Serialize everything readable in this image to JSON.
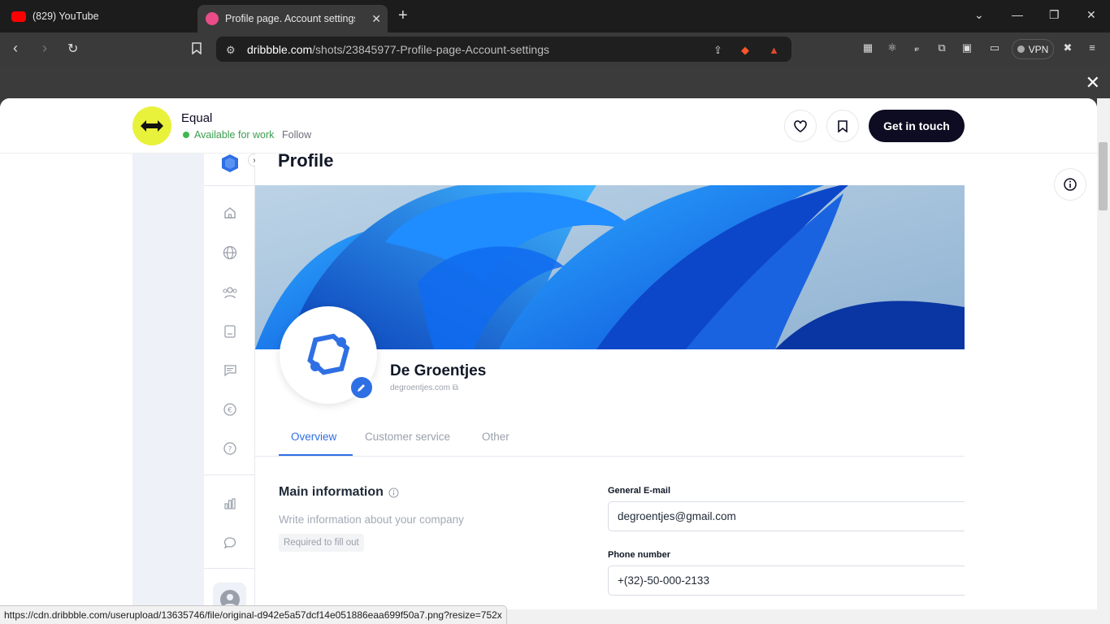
{
  "browser": {
    "tabs": [
      {
        "title": "(829) YouTube",
        "active": false
      },
      {
        "title": "Profile page. Account settings b",
        "active": true
      }
    ],
    "url_host": "dribbble.com",
    "url_path": "/shots/23845977-Profile-page-Account-settings",
    "vpn_label": "VPN",
    "status_url": "https://cdn.dribbble.com/userupload/13635746/file/original-d942e5a57dcf14e051886eaa699f50a7.png?resize=752x"
  },
  "header": {
    "brand": "Equal",
    "availability": "Available for work",
    "follow": "Follow",
    "cta": "Get in touch"
  },
  "shot": {
    "page_title": "Profile",
    "company_name": "De Groentjes",
    "company_domain": "degroentjes.com",
    "tabs": [
      "Overview",
      "Customer service",
      "Other"
    ],
    "active_tab": "Overview",
    "section_title": "Main information",
    "section_desc": "Write information about your company",
    "required_badge": "Required to fill out",
    "fields": [
      {
        "label": "General E-mail",
        "value": "degroentjes@gmail.com"
      },
      {
        "label": "Phone number",
        "value": "+(32)-50-000-2133"
      }
    ],
    "sidebar_icons": [
      "home-icon",
      "globe-icon",
      "users-icon",
      "document-icon",
      "message-icon",
      "euro-icon",
      "help-icon",
      "chart-icon",
      "chat-icon"
    ]
  },
  "colors": {
    "accent": "#2f6fe4",
    "brand_yellow": "#e9f23a",
    "available_green": "#3fb950",
    "dark": "#0d0c22"
  }
}
